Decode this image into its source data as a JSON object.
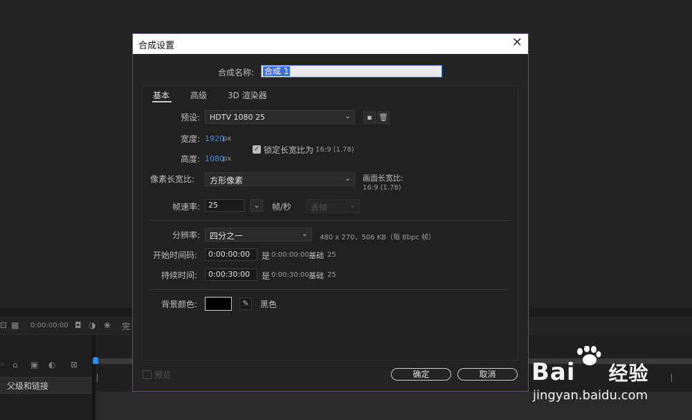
{
  "dialog": {
    "title": "合成设置",
    "close_glyph": "✕",
    "name_label": "合成名称:",
    "name_value": "合成 1",
    "tabs": [
      "基本",
      "高级",
      "3D 渲染器"
    ],
    "preset_label": "预设:",
    "preset_value": "HDTV 1080 25",
    "width_label": "宽度:",
    "width_value": "1920",
    "width_unit": "px",
    "height_label": "高度:",
    "height_value": "1080",
    "height_unit": "px",
    "lock_label": "锁定长宽比为",
    "lock_ratio": "16:9 (1.78)",
    "lock_checked": true,
    "pixel_aspect_label": "像素长宽比:",
    "pixel_aspect_value": "方形像素",
    "frame_aspect_label": "画面长宽比:",
    "frame_aspect_value": "16:9 (1.78)",
    "fps_label": "帧速率:",
    "fps_value": "25",
    "fps_unit": "帧/秒",
    "drop_frame_value": "丢帧",
    "resolution_label": "分辨率:",
    "resolution_value": "四分之一",
    "resolution_info": "480 x 270，506 KB（每 8bpc 帧）",
    "start_tc_label": "开始时间码:",
    "start_tc_value": "0:00:00:00",
    "start_tc_info_prefix": "是",
    "start_tc_info_value": "0:00:00:00",
    "start_tc_base_label": "基础",
    "start_tc_base_value": "25",
    "duration_label": "持续时间:",
    "duration_value": "0:00:30:00",
    "duration_info_prefix": "是",
    "duration_info_value": "0:00:30:00",
    "duration_base_label": "基础",
    "duration_base_value": "25",
    "bg_color_label": "背景颜色:",
    "bg_color_value": "#000000",
    "bg_color_name": "黑色",
    "preview_label": "预览",
    "ok_label": "确定",
    "cancel_label": "取消"
  },
  "background": {
    "toolbar_timecode": "0:00:00:00",
    "toolbar_partial": "完",
    "layer_header": "父级和链接"
  },
  "watermark": {
    "brand": "Bai",
    "brand_suffix": "经验",
    "url": "jingyan.baidu.com"
  },
  "colors": {
    "accent": "#3b6fd6",
    "blue_value": "#4a8fe0",
    "dialog_border": "#6a4a80"
  }
}
